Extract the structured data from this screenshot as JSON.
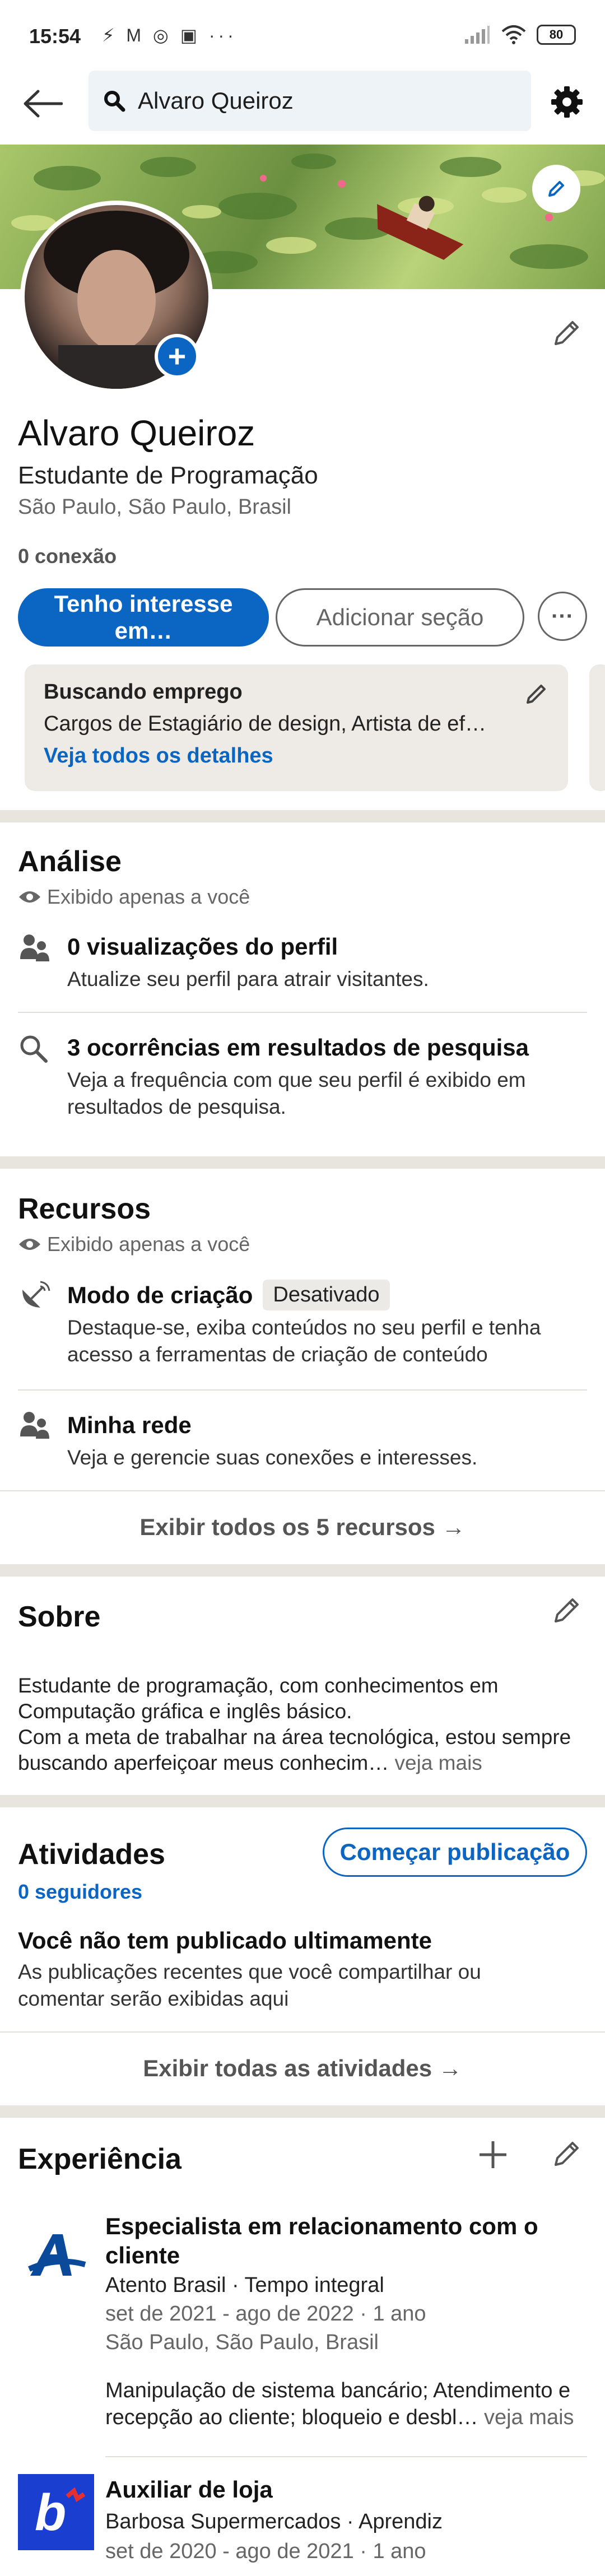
{
  "status_bar": {
    "time": "15:54",
    "battery": "80",
    "sys_icons": "⚡ M ◎ ▣ ···"
  },
  "search": {
    "value": "Alvaro Queiroz"
  },
  "profile": {
    "name": "Alvaro Queiroz",
    "headline": "Estudante de Programação",
    "location": "São Paulo, São Paulo, Brasil",
    "connections": "0 conexão",
    "primary_button": "Tenho interesse em…",
    "secondary_button": "Adicionar seção"
  },
  "open_to_work": {
    "title": "Buscando emprego",
    "description": "Cargos de Estagiário de design, Artista de ef…",
    "link": "Veja todos os detalhes"
  },
  "analytics": {
    "title": "Análise",
    "privacy": "Exibido apenas a você",
    "items": [
      {
        "title": "0 visualizações do perfil",
        "subtitle": "Atualize seu perfil para atrair visitantes."
      },
      {
        "title": "3 ocorrências em resultados de pesquisa",
        "subtitle": "Veja a frequência com que seu perfil é exibido em resultados de pesquisa."
      }
    ]
  },
  "resources": {
    "title": "Recursos",
    "privacy": "Exibido apenas a você",
    "items": [
      {
        "title": "Modo de criação",
        "badge": "Desativado",
        "subtitle": "Destaque-se, exiba conteúdos no seu perfil e tenha acesso a ferramentas de criação de conteúdo"
      },
      {
        "title": "Minha rede",
        "subtitle": "Veja e gerencie suas conexões e interesses."
      }
    ],
    "footer": "Exibir todos os 5 recursos"
  },
  "about": {
    "title": "Sobre",
    "text": "Estudante de programação, com conhecimentos em Computação gráfica e inglês básico.\nCom a meta de trabalhar na área tecnológica, estou sempre buscando aperfeiçoar meus conhecim…",
    "see_more": "veja mais"
  },
  "activity": {
    "title": "Atividades",
    "followers": "0 seguidores",
    "button": "Começar publicação",
    "empty_title": "Você não tem publicado ultimamente",
    "empty_text": "As publicações recentes que você compartilhar ou comentar serão exibidas aqui",
    "footer": "Exibir todas as atividades"
  },
  "experience": {
    "title": "Experiência",
    "items": [
      {
        "title": "Especialista em relacionamento com o cliente",
        "company": "Atento Brasil · Tempo integral",
        "dates": "set de 2021 - ago de 2022 · 1 ano",
        "location": "São Paulo, São Paulo, Brasil",
        "description": "Manipulação de sistema bancário; Atendimento e recepção ao cliente; bloqueio e desbl…",
        "see_more": "veja mais"
      },
      {
        "title": "Auxiliar de loja",
        "company": "Barbosa Supermercados · Aprendiz",
        "dates": "set de 2020 - ago de 2021 · 1 ano"
      }
    ]
  },
  "colors": {
    "accent": "#0a66c2",
    "divider": "#e8e5df",
    "card": "#eeebe6"
  }
}
